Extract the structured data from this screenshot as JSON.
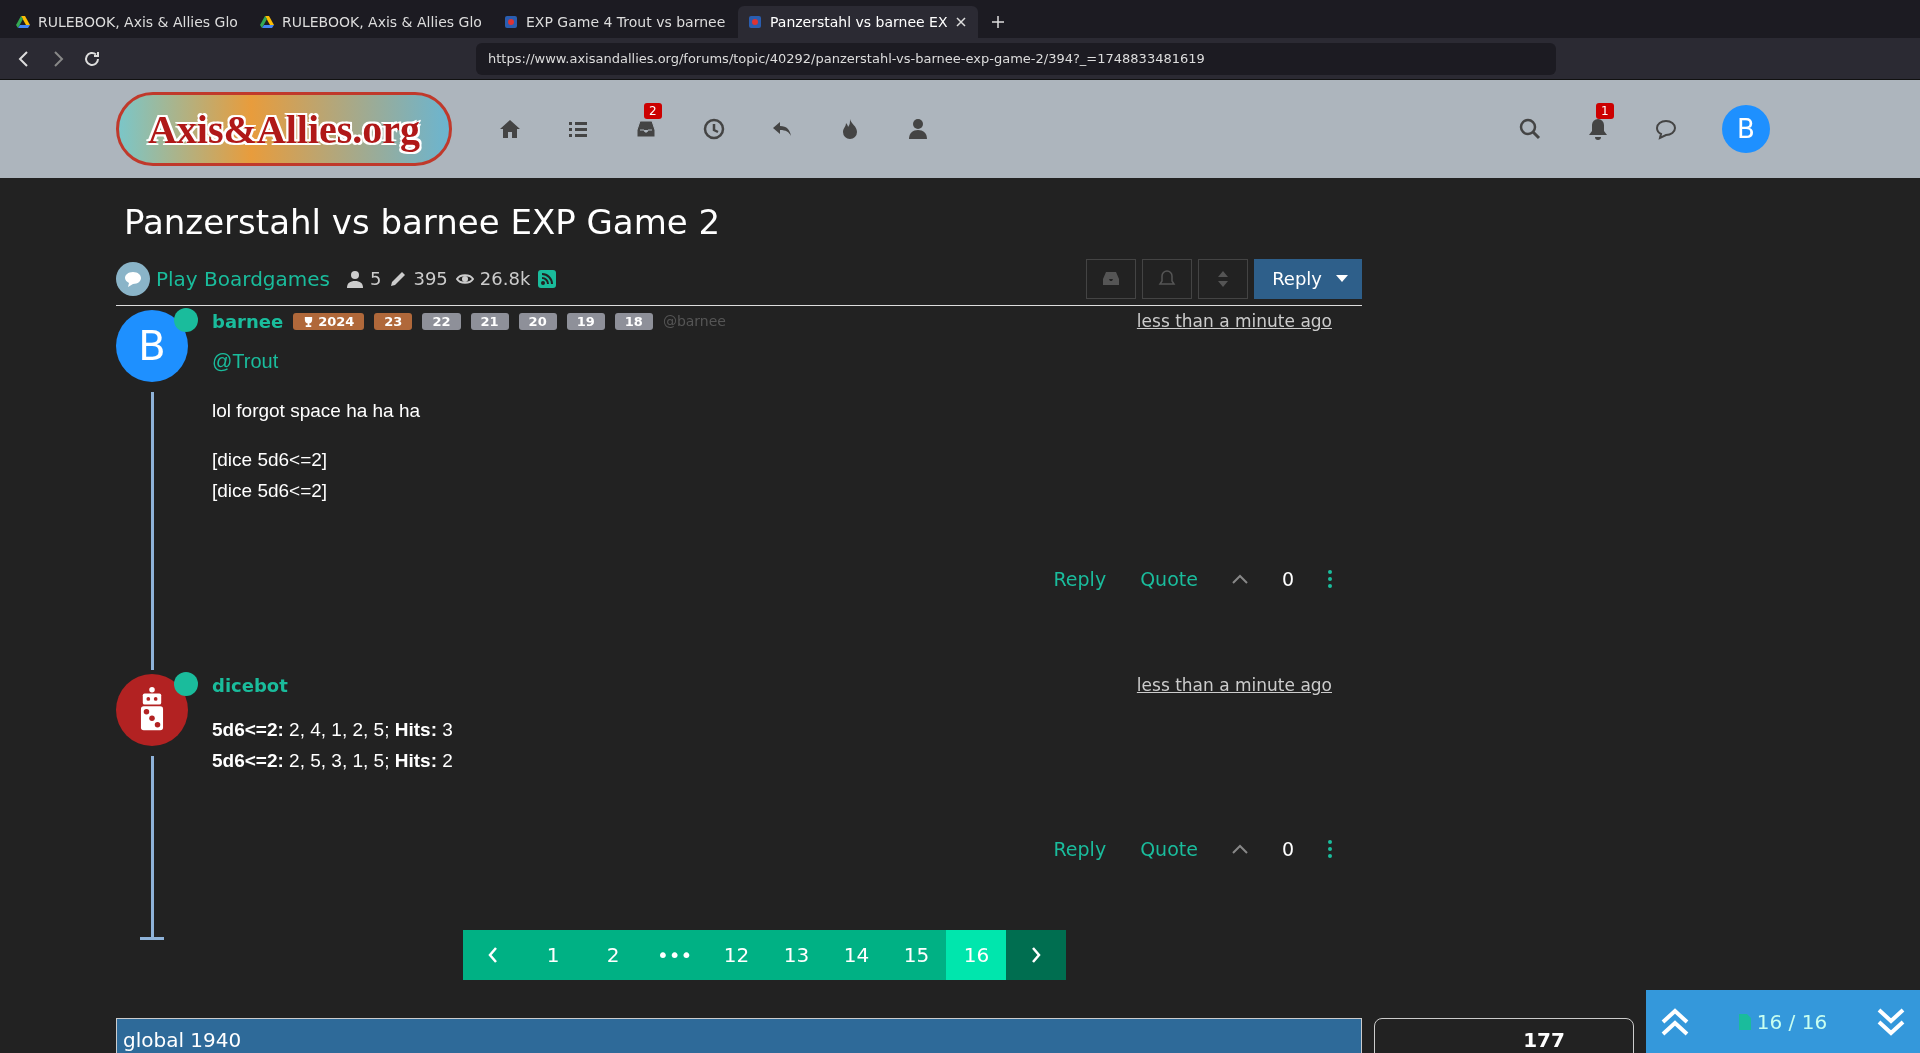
{
  "browser": {
    "tabs": [
      {
        "title": "RULEBOOK, Axis & Allies Glo",
        "selected": false
      },
      {
        "title": "RULEBOOK, Axis & Allies Glo",
        "selected": false
      },
      {
        "title": "EXP Game 4 Trout vs barnee",
        "selected": false
      },
      {
        "title": "Panzerstahl vs barnee EX",
        "selected": true
      }
    ],
    "url": "https://www.axisandallies.org/forums/topic/40292/panzerstahl-vs-barnee-exp-game-2/394?_=1748833481619"
  },
  "site_header": {
    "logo": "Axis&Allies.org",
    "inbox_count": "2",
    "notification_count": "1",
    "avatar": "B"
  },
  "topic": {
    "title": "Panzerstahl vs barnee EXP Game 2",
    "category": "Play Boardgames",
    "posters": "5",
    "posts": "395",
    "views": "26.8k",
    "reply_button": "Reply"
  },
  "posts": [
    {
      "author": "barnee",
      "avatar": "B",
      "online": true,
      "time": "less than a minute ago",
      "handle": "@barnee",
      "badges": [
        {
          "text": "2024",
          "color": "#b0683a",
          "trophy": true
        },
        {
          "text": "23",
          "color": "#b0683a",
          "trophy": false
        },
        {
          "text": "22",
          "color": "#8e9099",
          "trophy": false
        },
        {
          "text": "21",
          "color": "#8e9099",
          "trophy": false
        },
        {
          "text": "20",
          "color": "#8e9099",
          "trophy": false
        },
        {
          "text": "19",
          "color": "#8e9099",
          "trophy": false
        },
        {
          "text": "18",
          "color": "#8e9099",
          "trophy": false
        }
      ],
      "mention": "@Trout",
      "paragraphs": [
        [
          "lol forgot space ha ha ha"
        ],
        [
          "[dice 5d6<=2]",
          "[dice 5d6<=2]"
        ]
      ],
      "reply": "Reply",
      "quote": "Quote",
      "votes": "0"
    },
    {
      "author": "dicebot",
      "online": true,
      "time": "less than a minute ago",
      "paragraphs": [
        [
          "**5d6<=2:** 2, 4, 1, 2, 5; **Hits:** 3",
          "**5d6<=2:** 2, 5, 3, 1, 5; **Hits:** 2"
        ]
      ],
      "reply": "Reply",
      "quote": "Quote",
      "votes": "0"
    }
  ],
  "pagination": {
    "pages": [
      {
        "label": "1",
        "selected": false
      },
      {
        "label": "2",
        "selected": false
      },
      {
        "label": "•••",
        "selected": false
      },
      {
        "label": "12",
        "selected": false
      },
      {
        "label": "13",
        "selected": false
      },
      {
        "label": "14",
        "selected": false
      },
      {
        "label": "15",
        "selected": false
      },
      {
        "label": "16",
        "selected": true
      }
    ]
  },
  "footer": {
    "field_value": "global 1940",
    "count": "177",
    "position": "16 / 16"
  }
}
